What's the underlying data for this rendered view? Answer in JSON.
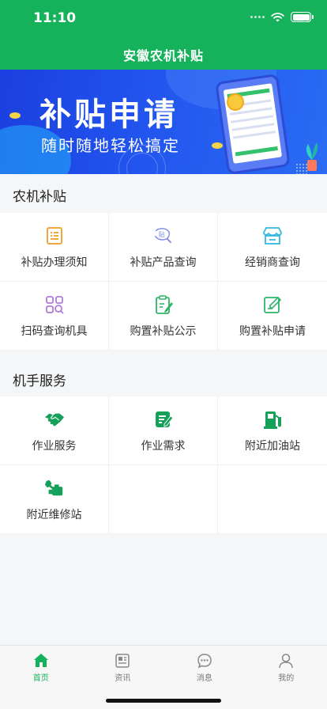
{
  "status_bar": {
    "time": "11:10"
  },
  "nav": {
    "title": "安徽农机补贴"
  },
  "banner": {
    "title": "补贴申请",
    "subtitle": "随时随地轻松搞定"
  },
  "sections": {
    "agri": {
      "title": "农机补贴",
      "items": [
        {
          "label": "补贴办理须知",
          "icon": "notice-doc-icon",
          "color": "#f2a73b"
        },
        {
          "label": "补贴产品查询",
          "icon": "subsidy-search-icon",
          "color": "#7a86e6"
        },
        {
          "label": "经销商查询",
          "icon": "store-icon",
          "color": "#35b8e0"
        },
        {
          "label": "扫码查询机具",
          "icon": "scan-grid-icon",
          "color": "#b07ad6"
        },
        {
          "label": "购置补贴公示",
          "icon": "clipboard-edit-icon",
          "color": "#2fb56a"
        },
        {
          "label": "购置补贴申请",
          "icon": "form-edit-icon",
          "color": "#2fb56a"
        }
      ]
    },
    "machine": {
      "title": "机手服务",
      "items": [
        {
          "label": "作业服务",
          "icon": "handshake-icon",
          "color": "#16a15a"
        },
        {
          "label": "作业需求",
          "icon": "document-edit-icon",
          "color": "#16a15a"
        },
        {
          "label": "附近加油站",
          "icon": "gas-station-icon",
          "color": "#16a15a"
        },
        {
          "label": "附近维修站",
          "icon": "repair-tool-icon",
          "color": "#16a15a"
        }
      ]
    }
  },
  "tabs": [
    {
      "label": "首页",
      "icon": "home-icon",
      "active": true
    },
    {
      "label": "资讯",
      "icon": "news-icon",
      "active": false
    },
    {
      "label": "消息",
      "icon": "message-icon",
      "active": false
    },
    {
      "label": "我的",
      "icon": "profile-icon",
      "active": false
    }
  ],
  "colors": {
    "brand": "#16b25b",
    "banner": "#2255ee"
  }
}
